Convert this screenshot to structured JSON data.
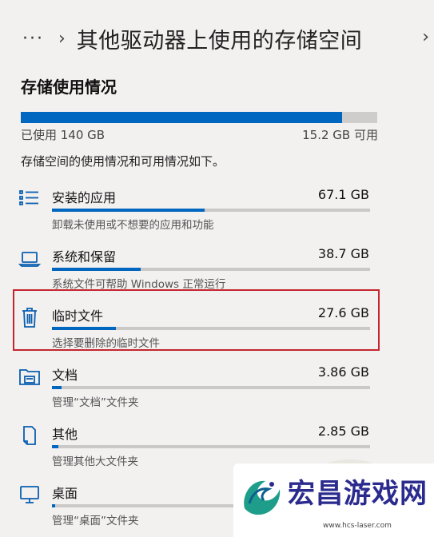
{
  "breadcrumb": {
    "more": "···",
    "chevron": "›",
    "title": "其他驱动器上使用的存储空间",
    "chevron_right": "›"
  },
  "section_title": "存储使用情况",
  "storage": {
    "used_label": "已使用 140 GB",
    "free_label": "15.2 GB 可用",
    "used_fraction": 0.902
  },
  "description": "存储空间的使用情况和可用情况如下。",
  "categories": [
    {
      "name": "安装的应用",
      "size": "67.1 GB",
      "subtitle": "卸载未使用或不想要的应用和功能",
      "icon": "apps-list-icon",
      "fraction": 0.48
    },
    {
      "name": "系统和保留",
      "size": "38.7 GB",
      "subtitle": "系统文件可帮助 Windows 正常运行",
      "icon": "laptop-icon",
      "fraction": 0.28
    },
    {
      "name": "临时文件",
      "size": "27.6 GB",
      "subtitle": "选择要删除的临时文件",
      "icon": "trash-icon",
      "fraction": 0.2
    },
    {
      "name": "文档",
      "size": "3.86 GB",
      "subtitle": "管理“文档”文件夹",
      "icon": "documents-folder-icon",
      "fraction": 0.03
    },
    {
      "name": "其他",
      "size": "2.85 GB",
      "subtitle": "管理其他大文件夹",
      "icon": "other-file-icon",
      "fraction": 0.02
    },
    {
      "name": "桌面",
      "size": "",
      "subtitle": "管理“桌面”文件夹",
      "icon": "desktop-monitor-icon",
      "fraction": 0.01
    }
  ],
  "watermark": {
    "text": "宏昌游戏网",
    "url": "www.hcs-laser.com"
  },
  "colors": {
    "accent": "#0067c0",
    "highlight": "#c4262e",
    "background": "#f3f0f0"
  }
}
